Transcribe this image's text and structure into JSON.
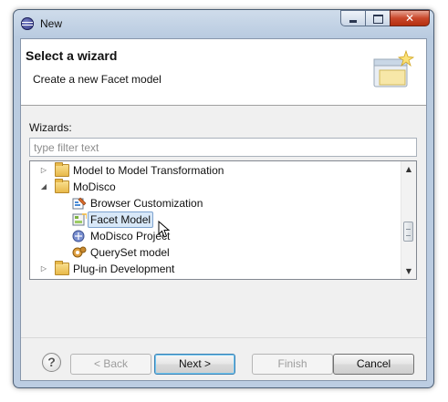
{
  "window": {
    "title": "New"
  },
  "banner": {
    "title": "Select a wizard",
    "description": "Create a new Facet model"
  },
  "wizards": {
    "label": "Wizards:",
    "filter_placeholder": "type filter text",
    "items": [
      {
        "label": "Model to Model Transformation",
        "expanded": false,
        "icon": "folder-icon",
        "level": 0
      },
      {
        "label": "MoDisco",
        "expanded": true,
        "icon": "folder-icon",
        "level": 0
      },
      {
        "label": "Browser Customization",
        "icon": "browser-customization-icon",
        "level": 1
      },
      {
        "label": "Facet Model",
        "icon": "facet-model-icon",
        "level": 1,
        "selected": true
      },
      {
        "label": "MoDisco Project",
        "icon": "modisco-project-icon",
        "level": 1
      },
      {
        "label": "QuerySet model",
        "icon": "queryset-model-icon",
        "level": 1
      },
      {
        "label": "Plug-in Development",
        "expanded": false,
        "icon": "folder-icon",
        "level": 0
      }
    ]
  },
  "buttons": {
    "help": "?",
    "back": "< Back",
    "next": "Next >",
    "finish": "Finish",
    "cancel": "Cancel"
  },
  "colors": {
    "selection": "#d8e8f8",
    "titlebar": "#b9cbe0",
    "close": "#c9472b"
  }
}
